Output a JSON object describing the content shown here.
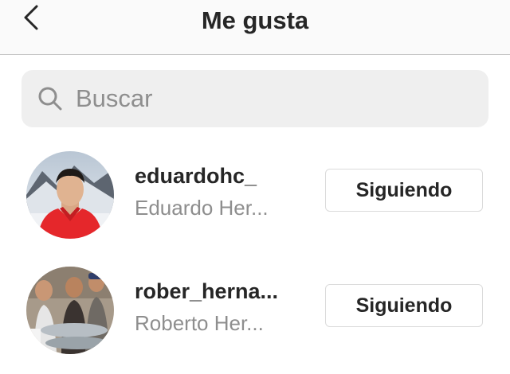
{
  "header": {
    "title": "Me gusta",
    "back_icon": "chevron-left-icon"
  },
  "search": {
    "placeholder": "Buscar",
    "value": "",
    "icon": "search-icon"
  },
  "users": [
    {
      "username": "eduardohc_",
      "full_name": "Eduardo Her...",
      "button_label": "Siguiendo"
    },
    {
      "username": "rober_herna...",
      "full_name": "Roberto Her...",
      "button_label": "Siguiendo"
    }
  ],
  "colors": {
    "text_primary": "#262626",
    "text_secondary": "#8e8e8e",
    "search_bg": "#efefef",
    "header_bg": "#fafafa",
    "button_border": "#dbdbdb"
  }
}
